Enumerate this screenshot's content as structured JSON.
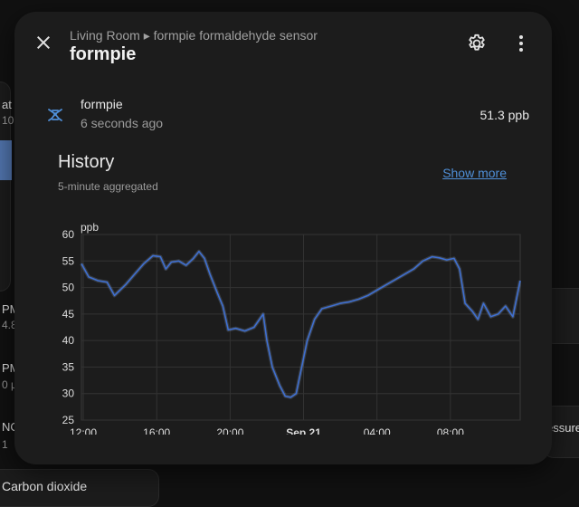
{
  "background": {
    "left_items": [
      {
        "title": "at",
        "value": "10"
      },
      {
        "title": "PM",
        "value": "4.8"
      },
      {
        "title": "PM",
        "value": "0 µ"
      },
      {
        "title": "NO",
        "value": "1"
      }
    ],
    "right_item": "essure",
    "bottom_item": "Carbon dioxide"
  },
  "dialog": {
    "breadcrumb": "Living Room ▸ formpie formaldehyde sensor",
    "title": "formpie",
    "icons": {
      "close": "close-icon",
      "settings": "gear-icon",
      "more": "more-vertical-icon"
    }
  },
  "entity": {
    "name": "formpie",
    "last_changed": "6 seconds ago",
    "state": "51.3 ppb",
    "icon": "molecule-icon"
  },
  "history": {
    "title": "History",
    "subtitle": "5-minute aggregated",
    "show_more": "Show more"
  },
  "colors": {
    "accent": "#4f8fd8",
    "line": "#3f6fd0",
    "dialog_bg": "#1c1c1c",
    "page_bg": "#111111"
  },
  "chart_data": {
    "type": "line",
    "ylabel": "ppb",
    "ylim": [
      25,
      60
    ],
    "yticks": [
      25,
      30,
      35,
      40,
      45,
      50,
      55,
      60
    ],
    "xlim": [
      11.9,
      35.8
    ],
    "xticks": [
      {
        "h": 12,
        "label": "12:00",
        "bold": false
      },
      {
        "h": 16,
        "label": "16:00",
        "bold": false
      },
      {
        "h": 20,
        "label": "20:00",
        "bold": false
      },
      {
        "h": 24,
        "label": "Sep 21",
        "bold": true
      },
      {
        "h": 28,
        "label": "04:00",
        "bold": false
      },
      {
        "h": 32,
        "label": "08:00",
        "bold": false
      }
    ],
    "grid": true,
    "series": [
      {
        "x": [
          11.9,
          12.3,
          12.8,
          13.3,
          13.7,
          14.3,
          14.8,
          15.3,
          15.8,
          16.2,
          16.5,
          16.8,
          17.2,
          17.6,
          18.0,
          18.3,
          18.6,
          18.9,
          19.3,
          19.6,
          19.9,
          20.3,
          20.8,
          21.3,
          21.8,
          22.0,
          22.3,
          22.7,
          23.0,
          23.3,
          23.6,
          23.9,
          24.2,
          24.6,
          25.0,
          25.5,
          26.0,
          26.5,
          27.0,
          27.5,
          28.0,
          28.5,
          29.0,
          29.5,
          30.0,
          30.5,
          31.0,
          31.4,
          31.8,
          32.2,
          32.5,
          32.8,
          33.2,
          33.5,
          33.8,
          34.2,
          34.6,
          35.0,
          35.4,
          35.8
        ],
        "y": [
          54.5,
          52.0,
          51.3,
          51.0,
          48.5,
          50.5,
          52.5,
          54.5,
          56.0,
          55.8,
          53.5,
          54.8,
          55.0,
          54.2,
          55.5,
          56.8,
          55.5,
          52.5,
          49.0,
          46.5,
          42.0,
          42.3,
          41.8,
          42.5,
          45.0,
          40.0,
          35.0,
          31.5,
          29.5,
          29.3,
          30.0,
          35.0,
          40.0,
          44.0,
          46.0,
          46.5,
          47.0,
          47.3,
          47.8,
          48.5,
          49.5,
          50.5,
          51.5,
          52.5,
          53.5,
          55.0,
          55.8,
          55.6,
          55.2,
          55.5,
          53.5,
          47.0,
          45.5,
          44.0,
          47.0,
          44.5,
          45.0,
          46.5,
          44.5,
          51.3
        ]
      }
    ]
  }
}
